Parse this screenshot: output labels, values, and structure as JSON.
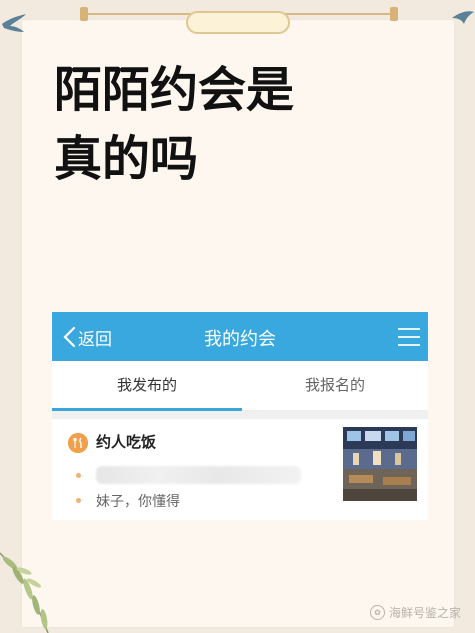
{
  "headline": {
    "line1": "陌陌约会是",
    "line2": "真的吗"
  },
  "app": {
    "back_label": "返回",
    "title": "我的约会",
    "tabs": [
      {
        "label": "我发布的",
        "active": true
      },
      {
        "label": "我报名的",
        "active": false
      }
    ],
    "item": {
      "icon": "fork-knife-icon",
      "title": "约人吃饭",
      "description": "妹子，你懂得"
    },
    "colors": {
      "header": "#38a8df",
      "accent": "#f0a04b"
    }
  },
  "watermark": {
    "text": "海鲜号鉴之家"
  }
}
